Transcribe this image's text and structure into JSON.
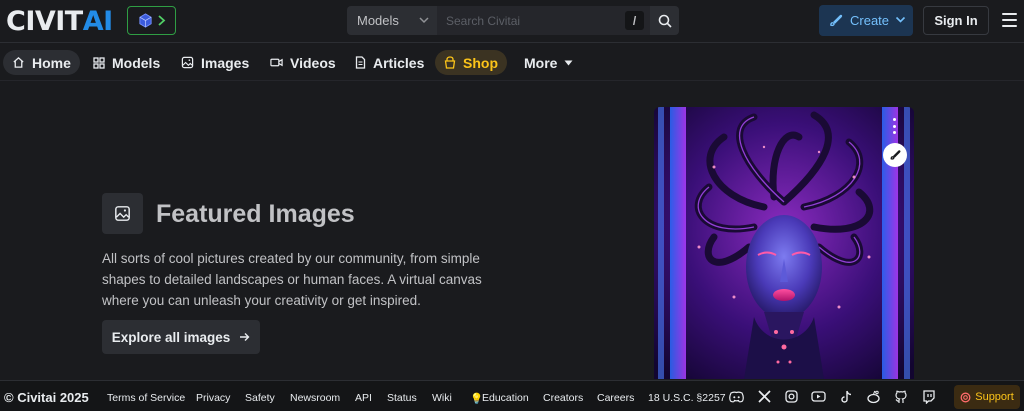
{
  "header": {
    "logo_white": "CIVIT",
    "logo_blue": "AI",
    "search_type": "Models",
    "search_placeholder": "Search Civitai",
    "search_shortcut": "/",
    "create_label": "Create",
    "signin_label": "Sign In"
  },
  "nav": {
    "items": [
      {
        "label": "Home",
        "icon": "home-icon"
      },
      {
        "label": "Models",
        "icon": "grid-icon"
      },
      {
        "label": "Images",
        "icon": "photo-icon"
      },
      {
        "label": "Videos",
        "icon": "video-icon"
      },
      {
        "label": "Articles",
        "icon": "article-icon"
      },
      {
        "label": "Shop",
        "icon": "basket-icon"
      },
      {
        "label": "More",
        "icon": "caret-down-icon"
      }
    ]
  },
  "main": {
    "title": "Featured Images",
    "description": "All sorts of cool pictures created by our community, from simple shapes to detailed landscapes or human faces. A virtual canvas where you can unleash your creativity or get inspired.",
    "explore_label": "Explore all images"
  },
  "footer": {
    "copyright": "© Civitai 2025",
    "links": [
      "Terms of Service",
      "Privacy",
      "Safety",
      "Newsroom",
      "API",
      "Status",
      "Wiki",
      "Education",
      "Creators",
      "Careers",
      "18 U.S.C. §2257"
    ],
    "socials": [
      "discord-icon",
      "x-icon",
      "instagram-icon",
      "youtube-icon",
      "tiktok-icon",
      "reddit-icon",
      "github-icon",
      "twitch-icon"
    ],
    "support_label": "Support"
  },
  "colors": {
    "accent": "#228be6",
    "shop": "#fcc419",
    "background": "#1a1b1e"
  }
}
